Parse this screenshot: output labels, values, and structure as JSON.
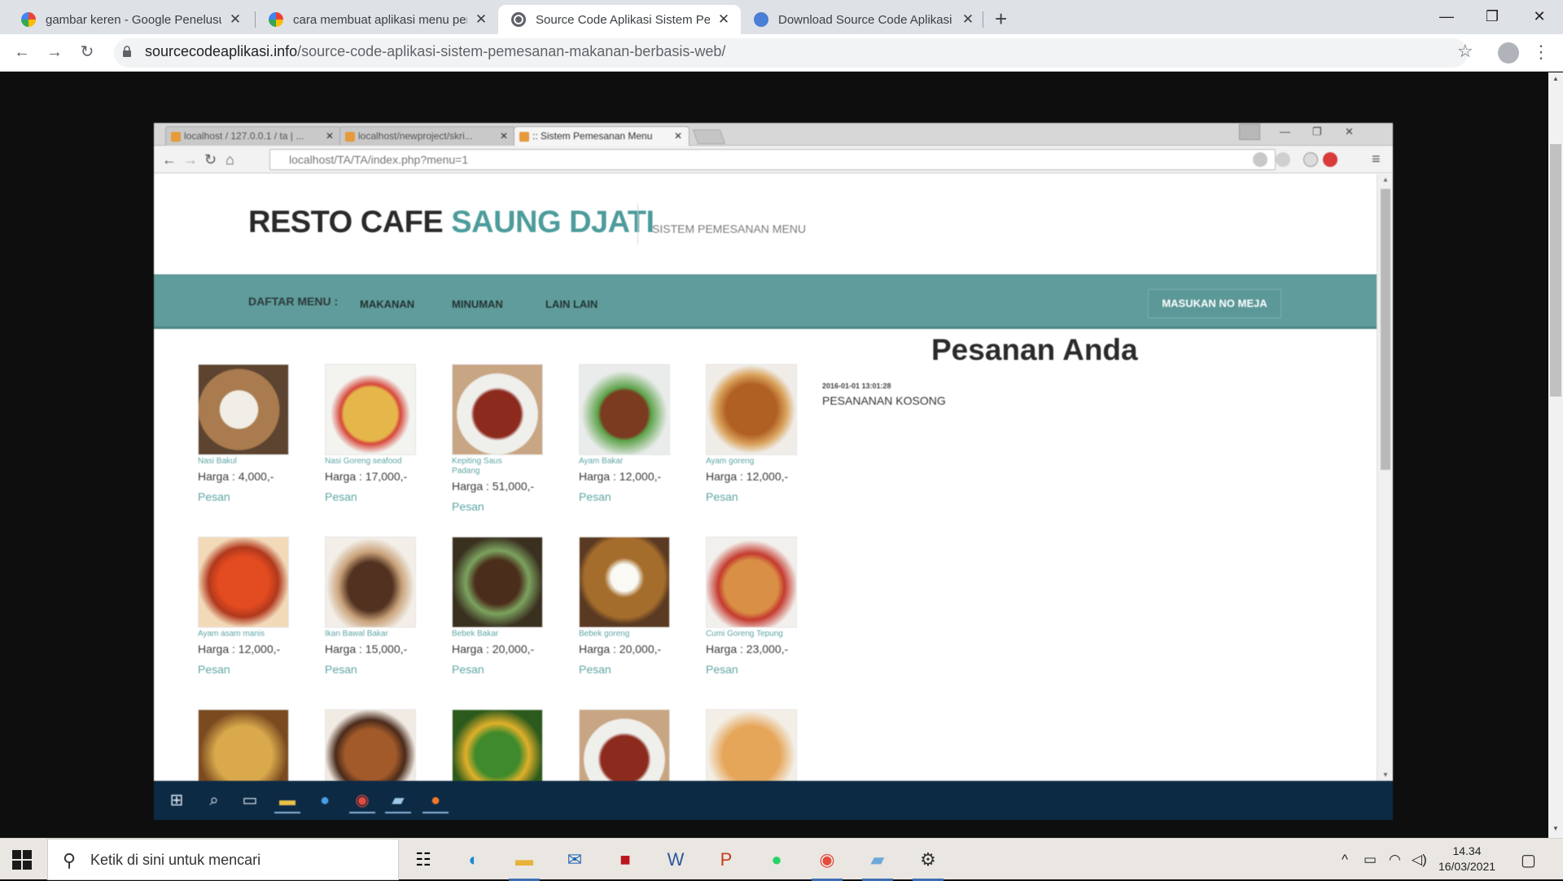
{
  "outer_browser": {
    "tabs": [
      {
        "title": "gambar keren - Google Penelusuran",
        "icon": "google-icon"
      },
      {
        "title": "cara membuat aplikasi menu pemesanan",
        "icon": "google-icon"
      },
      {
        "title": "Source Code Aplikasi Sistem Pemesanan",
        "icon": "globe-icon"
      },
      {
        "title": "Download Source Code Aplikasi Sistem",
        "icon": "globe-icon"
      }
    ],
    "url_domain": "sourcecodeaplikasi.info",
    "url_path": "/source-code-aplikasi-sistem-pemesanan-makanan-berbasis-web/"
  },
  "inner_browser": {
    "tabs": [
      {
        "title": "localhost / 127.0.0.1 / ta | ..."
      },
      {
        "title": "localhost/newproject/skri..."
      },
      {
        "title": ":: Sistem Pemesanan Menu"
      }
    ],
    "url": "localhost/TA/TA/index.php?menu=1"
  },
  "site": {
    "brand_main": "RESTO CAFE",
    "brand_accent": "SAUNG DJATI",
    "subtitle": "SISTEM PEMESANAN MENU",
    "nav_label": "DAFTAR MENU :",
    "nav_items": [
      "MAKANAN",
      "MINUMAN",
      "LAIN LAIN"
    ],
    "table_button": "MASUKAN NO MEJA",
    "accent_color": "#5f9c9b"
  },
  "menu": [
    {
      "name": "Nasi Bakul",
      "price": "Harga : 4,000,-",
      "action": "Pesan"
    },
    {
      "name": "Nasi Goreng seafood",
      "price": "Harga : 17,000,-",
      "action": "Pesan"
    },
    {
      "name": "Kepiting Saus Padang",
      "price": "Harga : 51,000,-",
      "action": "Pesan"
    },
    {
      "name": "Ayam Bakar",
      "price": "Harga : 12,000,-",
      "action": "Pesan"
    },
    {
      "name": "Ayam goreng",
      "price": "Harga : 12,000,-",
      "action": "Pesan"
    },
    {
      "name": "Ayam asam manis",
      "price": "Harga : 12,000,-",
      "action": "Pesan"
    },
    {
      "name": "Ikan Bawal Bakar",
      "price": "Harga : 15,000,-",
      "action": "Pesan"
    },
    {
      "name": "Bebek Bakar",
      "price": "Harga : 20,000,-",
      "action": "Pesan"
    },
    {
      "name": "Bebek goreng",
      "price": "Harga : 20,000,-",
      "action": "Pesan"
    },
    {
      "name": "Cumi Goreng Tepung",
      "price": "Harga : 23,000,-",
      "action": "Pesan"
    }
  ],
  "order": {
    "title": "Pesanan Anda",
    "datetime": "2016-01-01 13:01:28",
    "status": "PESANANAN KOSONG"
  },
  "windows": {
    "search_placeholder": "Ketik di sini untuk mencari",
    "time": "14.34",
    "date": "16/03/2021"
  }
}
